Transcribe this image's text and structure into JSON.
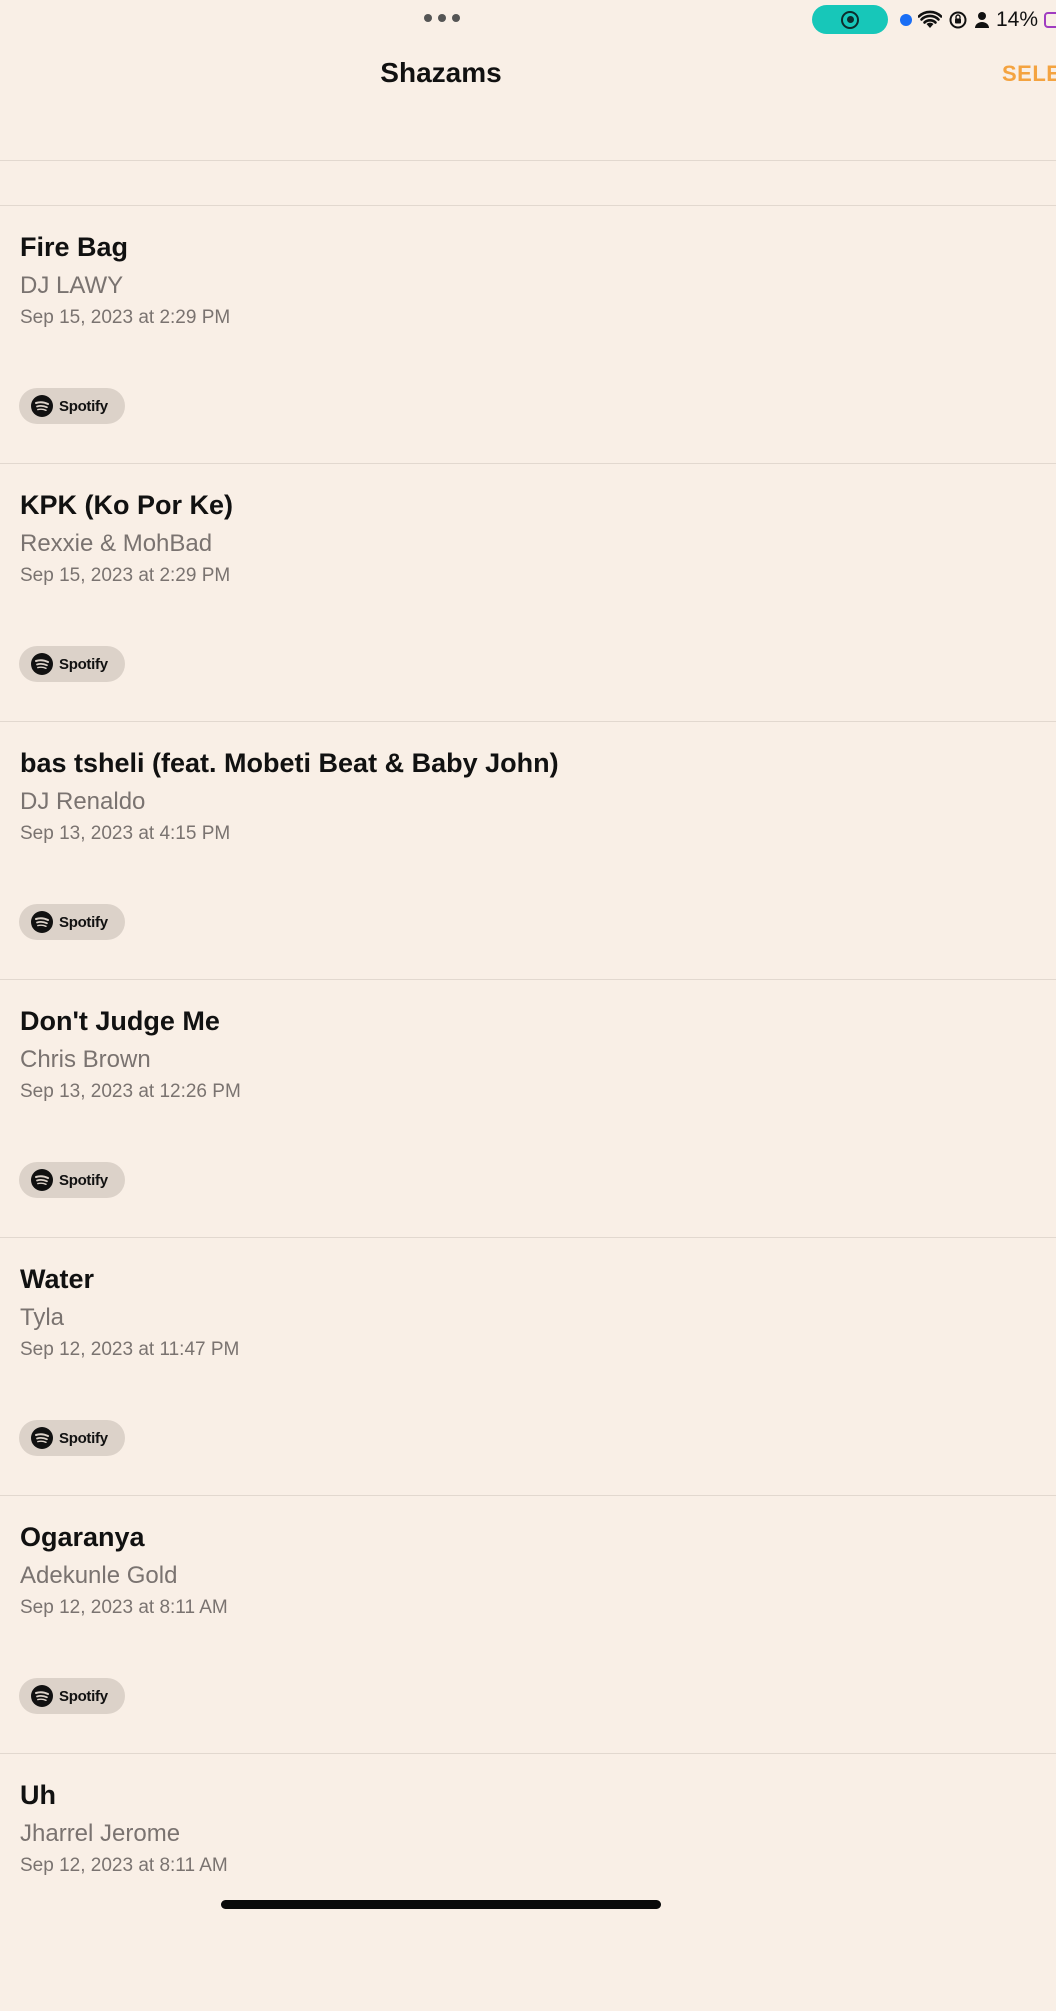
{
  "status_bar": {
    "battery_percent": "14%"
  },
  "header": {
    "title": "Shazams",
    "select_label": "SELE"
  },
  "songs": [
    {
      "title": "Fire Bag",
      "artist": "DJ LAWY",
      "date": "Sep 15, 2023 at 2:29 PM",
      "spotify_label": "Spotify"
    },
    {
      "title": "KPK (Ko Por Ke)",
      "artist": "Rexxie & MohBad",
      "date": "Sep 15, 2023 at 2:29 PM",
      "spotify_label": "Spotify"
    },
    {
      "title": "bas tsheli (feat. Mobeti Beat & Baby John)",
      "artist": "DJ Renaldo",
      "date": "Sep 13, 2023 at 4:15 PM",
      "spotify_label": "Spotify"
    },
    {
      "title": "Don't Judge Me",
      "artist": "Chris Brown",
      "date": "Sep 13, 2023 at 12:26 PM",
      "spotify_label": "Spotify"
    },
    {
      "title": "Water",
      "artist": "Tyla",
      "date": "Sep 12, 2023 at 11:47 PM",
      "spotify_label": "Spotify"
    },
    {
      "title": "Ogaranya",
      "artist": "Adekunle Gold",
      "date": "Sep 12, 2023 at 8:11 AM",
      "spotify_label": "Spotify"
    },
    {
      "title": "Uh",
      "artist": "Jharrel Jerome",
      "date": "Sep 12, 2023 at 8:11 AM",
      "spotify_label": ""
    }
  ]
}
